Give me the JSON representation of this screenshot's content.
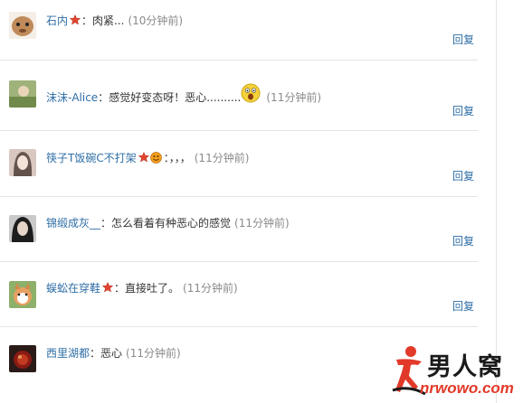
{
  "reply_label": "回复",
  "comments": [
    {
      "user": "石内",
      "sep": "：",
      "text": "肉紧...",
      "time": "(10分钟前)",
      "badge": "star",
      "emoji": ""
    },
    {
      "user": "沫沫-Alice",
      "sep": "：",
      "text": "感觉好变态呀！恶心..........",
      "time": "(11分钟前)",
      "badge": "",
      "emoji": "shocked-face-icon"
    },
    {
      "user": "筷子T饭碗C不打架",
      "sep": "：",
      "text": "，，，",
      "time": "(11分钟前)",
      "badge": "star",
      "emoji": "smile-face-icon"
    },
    {
      "user": "锦缎成灰__",
      "sep": "：",
      "text": "怎么看着有种恶心的感觉",
      "time": "(11分钟前)",
      "badge": "",
      "emoji": ""
    },
    {
      "user": "蜈蚣在穿鞋",
      "sep": "：",
      "text": "直接吐了。",
      "time": "(11分钟前)",
      "badge": "star",
      "emoji": ""
    },
    {
      "user": "西里湖都",
      "sep": "：",
      "text": "恶心",
      "time": "(11分钟前)",
      "badge": "",
      "emoji": ""
    }
  ],
  "watermark": {
    "brand": "男人窝",
    "url": "nrwowo.com"
  },
  "colors": {
    "username": "#2e6ea6",
    "reply": "#2e6ea6",
    "time": "#8a8a8a",
    "badge": "#e0452f",
    "watermark_url": "#e23a2a"
  }
}
